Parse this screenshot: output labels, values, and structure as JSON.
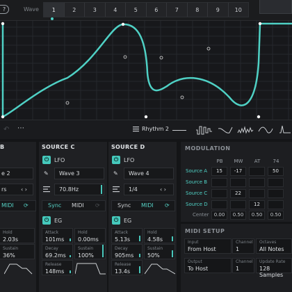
{
  "topbar": {
    "help_icon": "?",
    "wave_label": "Wave",
    "tabs": [
      "1",
      "2",
      "3",
      "4",
      "5",
      "6",
      "7",
      "8",
      "9",
      "10"
    ],
    "active_tab": "1"
  },
  "graph": {
    "accent": "#4fd1c5"
  },
  "presetbar": {
    "undo_icon": "undo-icon",
    "more_icon": "⋯",
    "preset_name": "Rhythm 2"
  },
  "sources": [
    {
      "title": "B",
      "wave_value": "e 2",
      "rate_value": "rs",
      "sync_label": "Sync",
      "midi_label": "MIDI",
      "eg": {
        "hold_label": "Hold",
        "hold_value": "2.03s",
        "sustain_label": "Sustain",
        "sustain_value": "36%"
      }
    },
    {
      "title": "SOURCE C",
      "lfo_label": "LFO",
      "wave_value": "Wave 3",
      "rate_value": "70.8Hz",
      "sync_label": "Sync",
      "midi_label": "MIDI",
      "eg_label": "EG",
      "eg": {
        "attack_label": "Attack",
        "attack_value": "101ms",
        "hold_label": "Hold",
        "hold_value": "0.00ms",
        "decay_label": "Decay",
        "decay_value": "69.2ms",
        "sustain_label": "Sustain",
        "sustain_value": "100%",
        "release_label": "Release",
        "release_value": "148ms"
      }
    },
    {
      "title": "SOURCE D",
      "lfo_label": "LFO",
      "wave_value": "Wave 4",
      "rate_value": "1/4",
      "sync_label": "Sync",
      "midi_label": "MIDI",
      "eg_label": "EG",
      "eg": {
        "attack_label": "Attack",
        "attack_value": "5.13s",
        "hold_label": "Hold",
        "hold_value": "4.58s",
        "decay_label": "Decay",
        "decay_value": "905ms",
        "sustain_label": "Sustain",
        "sustain_value": "50%",
        "release_label": "Release",
        "release_value": "13.4s"
      }
    }
  ],
  "modulation": {
    "title": "MODULATION",
    "headers": [
      "PB",
      "MW",
      "AT",
      "74",
      ""
    ],
    "rows": [
      {
        "label": "Source A",
        "cells": [
          "15",
          "-17",
          "",
          "",
          "50"
        ]
      },
      {
        "label": "Source B",
        "cells": [
          "",
          "",
          "",
          "",
          ""
        ]
      },
      {
        "label": "Source C",
        "cells": [
          "",
          "22",
          "",
          "",
          ""
        ]
      },
      {
        "label": "Source D",
        "cells": [
          "",
          "",
          "12",
          "",
          ""
        ]
      }
    ],
    "center": {
      "label": "Center",
      "cells": [
        "0.00",
        "0.50",
        "0.50",
        "0.50",
        "0.50"
      ]
    }
  },
  "midi_setup": {
    "title": "MIDI SETUP",
    "input_label": "Input",
    "input_value": "From Host",
    "channel_label": "Channel",
    "channel_value": "1",
    "octaves_label": "Octaves",
    "octaves_value": "All Notes",
    "output_label": "Output",
    "output_value": "To Host",
    "out_channel_label": "Channel",
    "out_channel_value": "1",
    "update_rate_label": "Update Rate",
    "update_rate_value": "128 Samples"
  }
}
